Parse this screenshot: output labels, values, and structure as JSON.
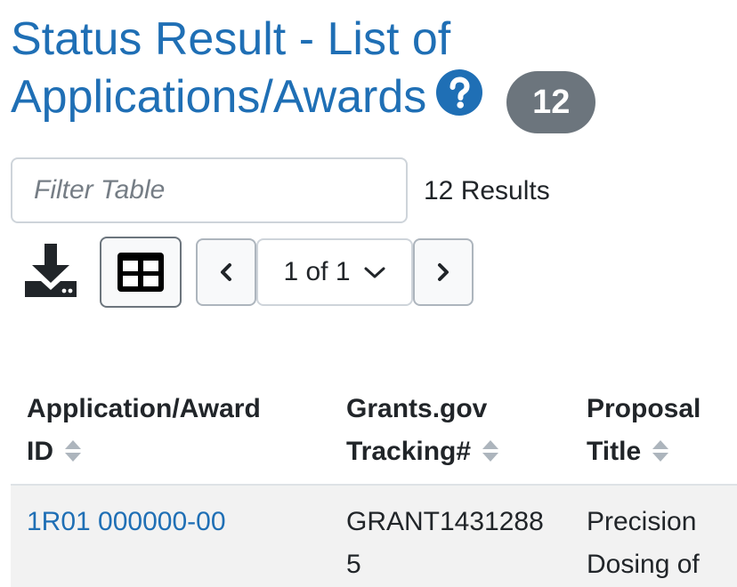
{
  "header": {
    "title_line1": "Status Result - List of",
    "title_line2": "Applications/Awards",
    "help_icon": "question-circle-icon",
    "count_badge": "12",
    "accent_color": "#1f6fb5",
    "badge_color": "#6c757d"
  },
  "filter": {
    "placeholder": "Filter Table",
    "value": "",
    "results_text": "12 Results"
  },
  "toolbar": {
    "download_icon": "download-icon",
    "column_toggle_icon": "table-grid-icon"
  },
  "pagination": {
    "page_label": "1 of 1",
    "prev_icon": "chevron-left-icon",
    "next_icon": "chevron-right-icon",
    "dropdown_icon": "chevron-down-icon"
  },
  "table": {
    "columns": [
      {
        "line1": "Application/Award",
        "line2": "ID",
        "sort_icon": "sort-icon"
      },
      {
        "line1": "Grants.gov",
        "line2": "Tracking#",
        "sort_icon": "sort-icon"
      },
      {
        "line1": "Proposal",
        "line2": "Title",
        "sort_icon": "sort-icon"
      }
    ],
    "rows": [
      {
        "id": "1R01 000000-00",
        "tracking_line1": "GRANT1431288",
        "tracking_line2": "5",
        "title_line1": "Precision",
        "title_line2": "Dosing of"
      }
    ]
  }
}
